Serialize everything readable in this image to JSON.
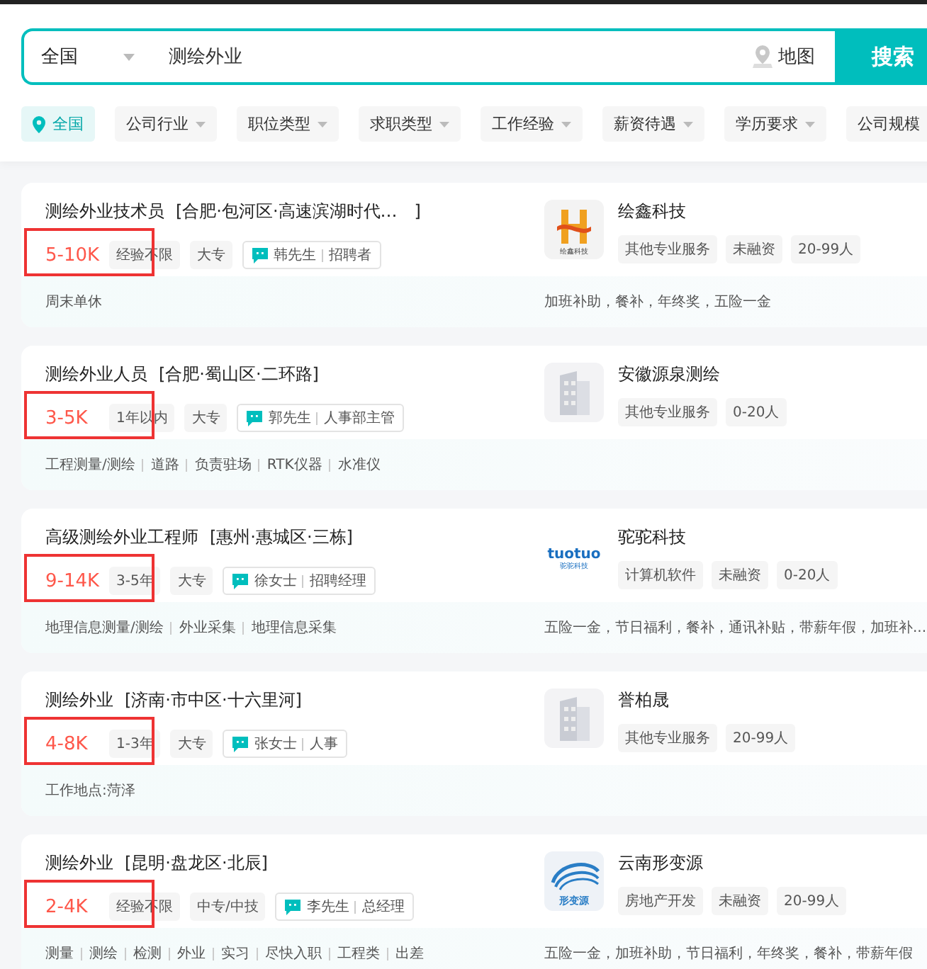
{
  "search": {
    "city": "全国",
    "query": "测绘外业",
    "map_label": "地图",
    "button": "搜索"
  },
  "filters": [
    {
      "label": "全国",
      "kind": "location",
      "selected": true
    },
    {
      "label": "公司行业",
      "kind": "dropdown",
      "selected": false
    },
    {
      "label": "职位类型",
      "kind": "dropdown",
      "selected": false
    },
    {
      "label": "求职类型",
      "kind": "dropdown",
      "selected": false
    },
    {
      "label": "工作经验",
      "kind": "dropdown",
      "selected": false
    },
    {
      "label": "薪资待遇",
      "kind": "dropdown",
      "selected": false
    },
    {
      "label": "学历要求",
      "kind": "dropdown",
      "selected": false
    },
    {
      "label": "公司规模",
      "kind": "dropdown",
      "selected": false
    }
  ],
  "jobs": [
    {
      "title": "测绘外业技术员",
      "location": "[合肥·包河区·高速滨湖时代…　]",
      "salary": "5-10K",
      "highlighted": true,
      "tags": [
        "经验不限",
        "大专"
      ],
      "recruiter": "韩先生",
      "recruiter_role": "招聘者",
      "company": "绘鑫科技",
      "logo": {
        "kind": "h-mark",
        "text": "绘鑫科技"
      },
      "company_tags": [
        "其他专业服务",
        "未融资",
        "20-99人"
      ],
      "skills": [
        "周末单休"
      ],
      "benefits": "加班补助，餐补，年终奖，五险一金"
    },
    {
      "title": "测绘外业人员",
      "location": "[合肥·蜀山区·二环路]",
      "salary": "3-5K",
      "highlighted": true,
      "tags": [
        "1年以内",
        "大专"
      ],
      "recruiter": "郭先生",
      "recruiter_role": "人事部主管",
      "company": "安徽源泉测绘",
      "logo": {
        "kind": "building"
      },
      "company_tags": [
        "其他专业服务",
        "0-20人"
      ],
      "skills": [
        "工程测量/测绘",
        "道路",
        "负责驻场",
        "RTK仪器",
        "水准仪"
      ]
    },
    {
      "title": "高级测绘外业工程师",
      "location": "[惠州·惠城区·三栋]",
      "salary": "9-14K",
      "highlighted": true,
      "tags": [
        "3-5年",
        "大专"
      ],
      "recruiter": "徐女士",
      "recruiter_role": "招聘经理",
      "company": "驼驼科技",
      "logo": {
        "kind": "wordmark",
        "text": "tuotuo",
        "subtext": "驼驼科技"
      },
      "company_tags": [
        "计算机软件",
        "未融资",
        "0-20人"
      ],
      "skills": [
        "地理信息测量/测绘",
        "外业采集",
        "地理信息采集"
      ],
      "benefits": "五险一金，节日福利，餐补，通讯补贴，带薪年假，加班补..."
    },
    {
      "title": "测绘外业",
      "location": "[济南·市中区·十六里河]",
      "salary": "4-8K",
      "highlighted": true,
      "tags": [
        "1-3年",
        "大专"
      ],
      "recruiter": "张女士",
      "recruiter_role": "人事",
      "company": "誉柏晟",
      "logo": {
        "kind": "building"
      },
      "company_tags": [
        "其他专业服务",
        "20-99人"
      ],
      "skills": [
        "工作地点:菏泽"
      ]
    },
    {
      "title": "测绘外业",
      "location": "[昆明·盘龙区·北辰]",
      "salary": "2-4K",
      "highlighted": true,
      "tags": [
        "经验不限",
        "中专/中技"
      ],
      "recruiter": "李先生",
      "recruiter_role": "总经理",
      "company": "云南形变源",
      "logo": {
        "kind": "waves",
        "text": "形变源"
      },
      "company_tags": [
        "房地产开发",
        "未融资",
        "20-99人"
      ],
      "skills": [
        "测量",
        "测绘",
        "检测",
        "外业",
        "实习",
        "尽快入职",
        "工程类",
        "出差"
      ],
      "benefits": "五险一金，加班补助，节日福利，年终奖，餐补，带薪年假"
    }
  ]
}
